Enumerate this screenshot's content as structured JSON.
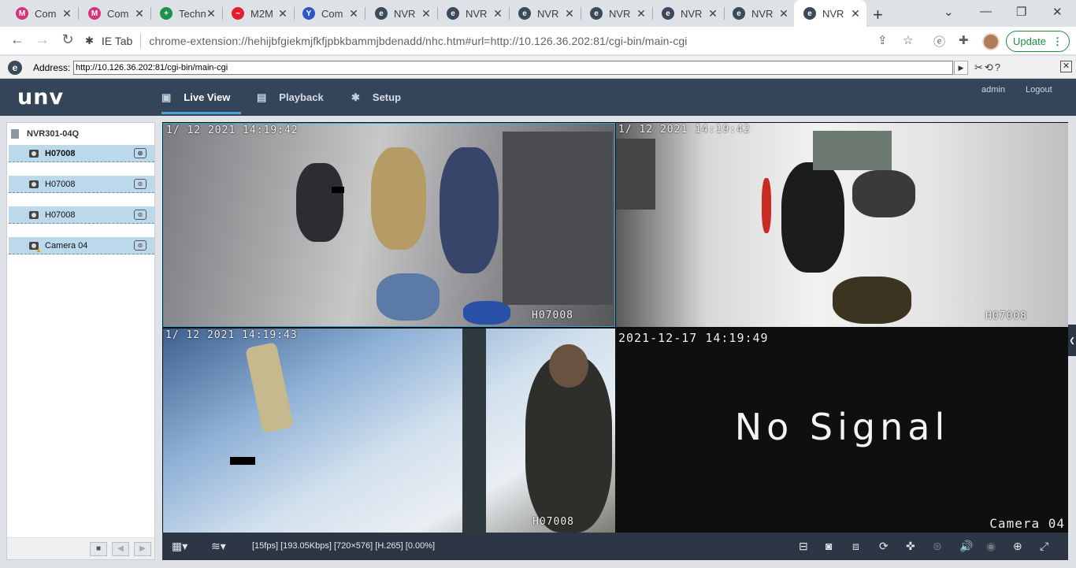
{
  "browser": {
    "tabs": [
      {
        "title": "Com",
        "favicon_color": "#d6337a",
        "favicon_char": "M"
      },
      {
        "title": "Com",
        "favicon_color": "#d6337a",
        "favicon_char": "M"
      },
      {
        "title": "Techn",
        "favicon_color": "#1f8f4e",
        "favicon_char": "+"
      },
      {
        "title": "M2M",
        "favicon_color": "#e0202e",
        "favicon_char": "~"
      },
      {
        "title": "Com",
        "favicon_color": "#2f56c9",
        "favicon_char": "Y"
      },
      {
        "title": "NVR",
        "favicon_color": "#3a4a5c",
        "favicon_char": "e"
      },
      {
        "title": "NVR",
        "favicon_color": "#3a4a5c",
        "favicon_char": "e"
      },
      {
        "title": "NVR",
        "favicon_color": "#3a4a5c",
        "favicon_char": "e"
      },
      {
        "title": "NVR",
        "favicon_color": "#3a4a5c",
        "favicon_char": "e"
      },
      {
        "title": "NVR",
        "favicon_color": "#3a4a5c",
        "favicon_char": "e"
      },
      {
        "title": "NVR",
        "favicon_color": "#3a4a5c",
        "favicon_char": "e"
      },
      {
        "title": "NVR",
        "favicon_color": "#3a4a5c",
        "favicon_char": "e"
      }
    ],
    "active_tab_index": 11,
    "new_tab": "+",
    "window_controls": {
      "dropdown": "⌄",
      "minimize": "—",
      "restore": "❐",
      "close": "✕"
    },
    "nav": {
      "back": "←",
      "forward": "→",
      "reload": "↻"
    },
    "omnibox": {
      "prefix_label": "IE Tab",
      "url": "chrome-extension://hehijbfgiekmjfkfjpbkbammjbdenadd/nhc.htm#url=http://10.126.36.202:81/cgi-bin/main-cgi"
    },
    "update_button": "Update"
  },
  "ietab": {
    "address_label": "Address:",
    "address_value": "http://10.126.36.202:81/cgi-bin/main-cgi",
    "go": "▶",
    "tools": "✂⟲?",
    "close": "✕"
  },
  "nvr": {
    "logo": "unv",
    "nav": [
      {
        "label": "Live View",
        "icon": "▣",
        "active": true
      },
      {
        "label": "Playback",
        "icon": "▤",
        "active": false
      },
      {
        "label": "Setup",
        "icon": "✱",
        "active": false
      }
    ],
    "user": "admin",
    "logout": "Logout",
    "device": "NVR301-04Q",
    "cameras": [
      {
        "name": "H07008",
        "bold": true,
        "warning": false
      },
      {
        "name": "H07008",
        "bold": false,
        "warning": false
      },
      {
        "name": "H07008",
        "bold": false,
        "warning": false
      },
      {
        "name": "Camera 04",
        "bold": false,
        "warning": true
      }
    ],
    "tiles": [
      {
        "timestamp": "1/ 12 2021 14:19:42",
        "channel_label": "H07008"
      },
      {
        "timestamp": "1/ 12 2021 14:19:42",
        "channel_label": "H07008"
      },
      {
        "timestamp": "1/ 12 2021 14:19:43",
        "channel_label": "H07008"
      },
      {
        "timestamp": "2021-12-17 14:19:49",
        "channel_label": "Camera 04",
        "message": "No Signal"
      }
    ],
    "stream_status": "[15fps] [193.05Kbps] [720×576] [H.265] [0.00%]"
  }
}
